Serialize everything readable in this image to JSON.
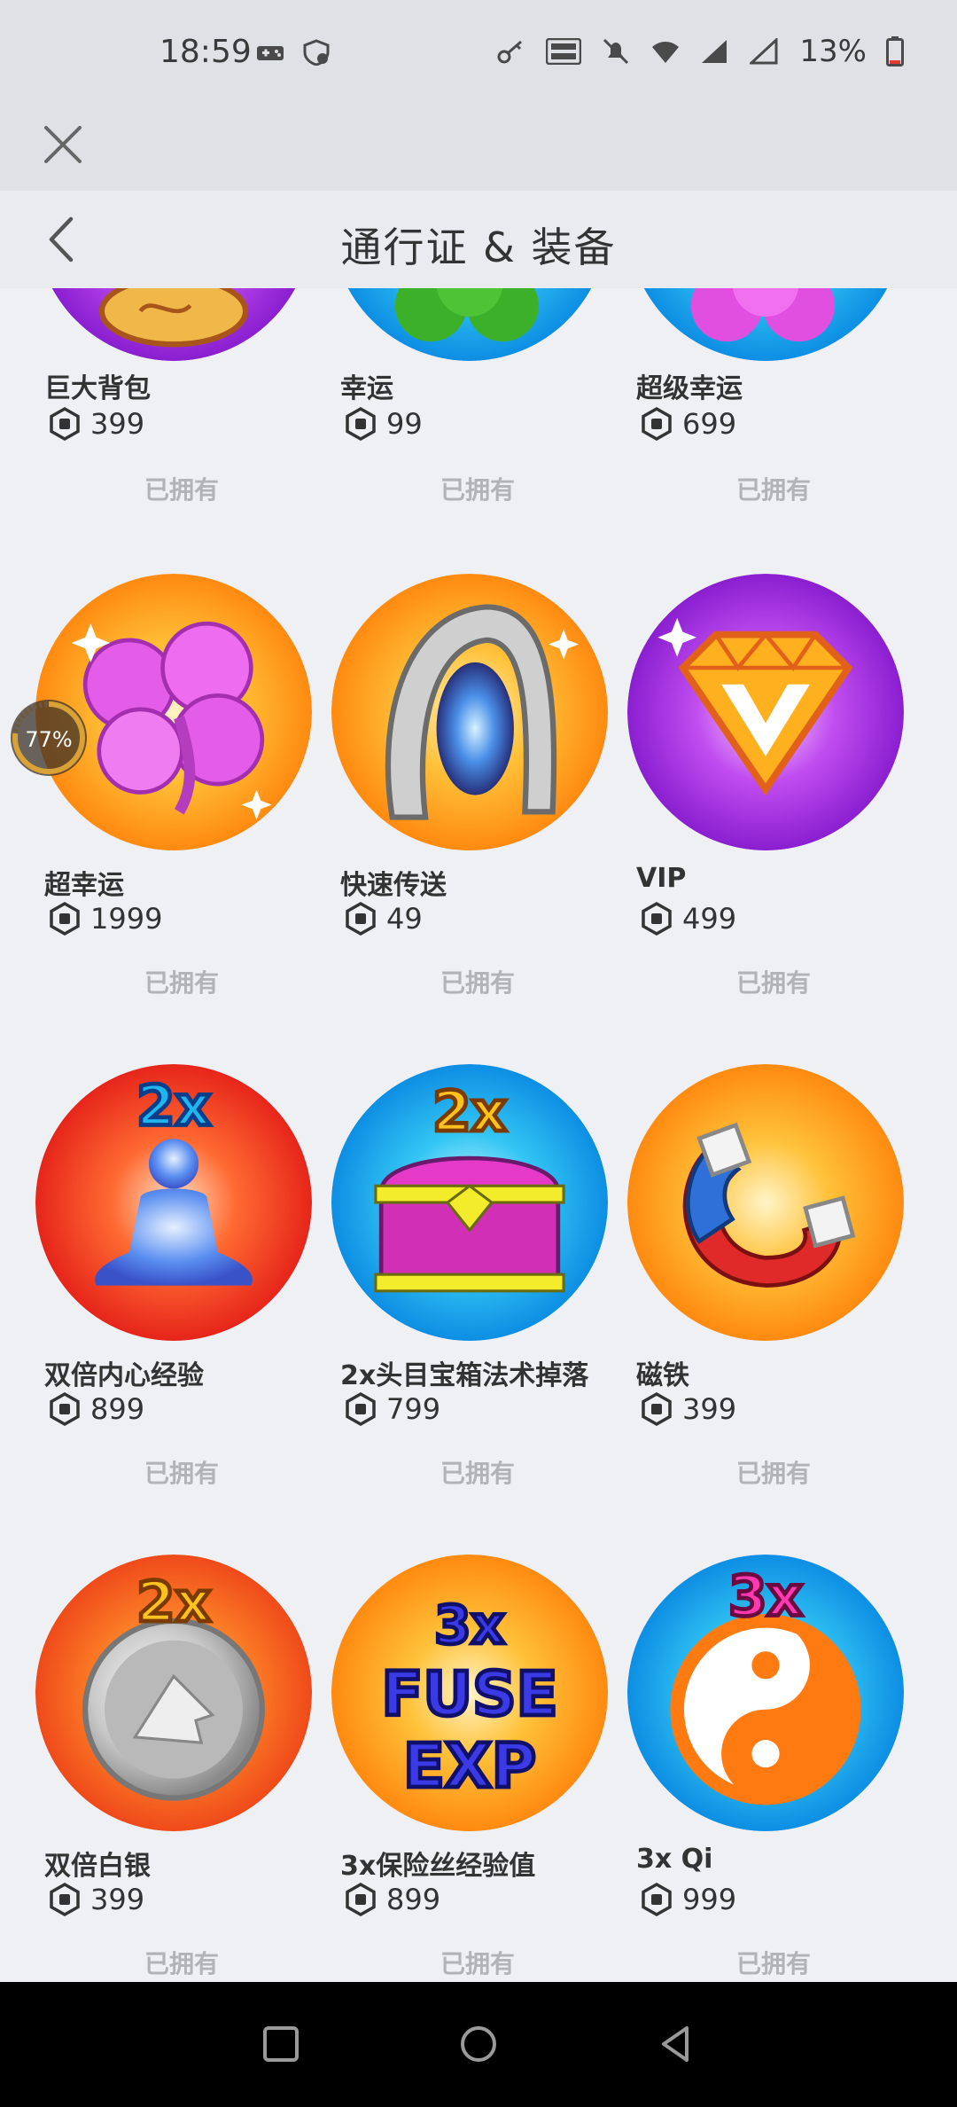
{
  "status": {
    "time": "18:59",
    "battery": "13%"
  },
  "header": {
    "title": "通行证 & 装备"
  },
  "items": [
    {
      "name": "巨大背包",
      "price": "399",
      "status": "已拥有",
      "art": "backpack"
    },
    {
      "name": "幸运",
      "price": "99",
      "status": "已拥有",
      "art": "clover-green"
    },
    {
      "name": "超级幸运",
      "price": "699",
      "status": "已拥有",
      "art": "clover-pink"
    },
    {
      "name": "超幸运",
      "price": "1999",
      "status": "已拥有",
      "art": "clover-pink-big"
    },
    {
      "name": "快速传送",
      "price": "49",
      "status": "已拥有",
      "art": "portal"
    },
    {
      "name": "VIP",
      "price": "499",
      "status": "已拥有",
      "art": "vip-gem"
    },
    {
      "name": "双倍内心经验",
      "price": "899",
      "status": "已拥有",
      "art": "2x-meditate"
    },
    {
      "name": "2x头目宝箱法术掉落",
      "price": "799",
      "status": "已拥有",
      "art": "2x-chest"
    },
    {
      "name": "磁铁",
      "price": "399",
      "status": "已拥有",
      "art": "magnet"
    },
    {
      "name": "双倍白银",
      "price": "399",
      "status": "已拥有",
      "art": "2x-silver"
    },
    {
      "name": "3x保险丝经验值",
      "price": "899",
      "status": "已拥有",
      "art": "3x-fuse-exp"
    },
    {
      "name": "3x Qi",
      "price": "999",
      "status": "已拥有",
      "art": "3x-qi"
    }
  ],
  "overlay": {
    "progress_label": "77%",
    "progress": 0.77
  },
  "art_text": {
    "x2": "2x",
    "x3": "3x",
    "fuse": "FUSE",
    "exp": "EXP"
  },
  "colors": {
    "orange_burst": "#ff9a1a",
    "blue_burst": "#1fb6ef",
    "purple_burst": "#a32ee0",
    "red_burst": "#f03a1e"
  }
}
